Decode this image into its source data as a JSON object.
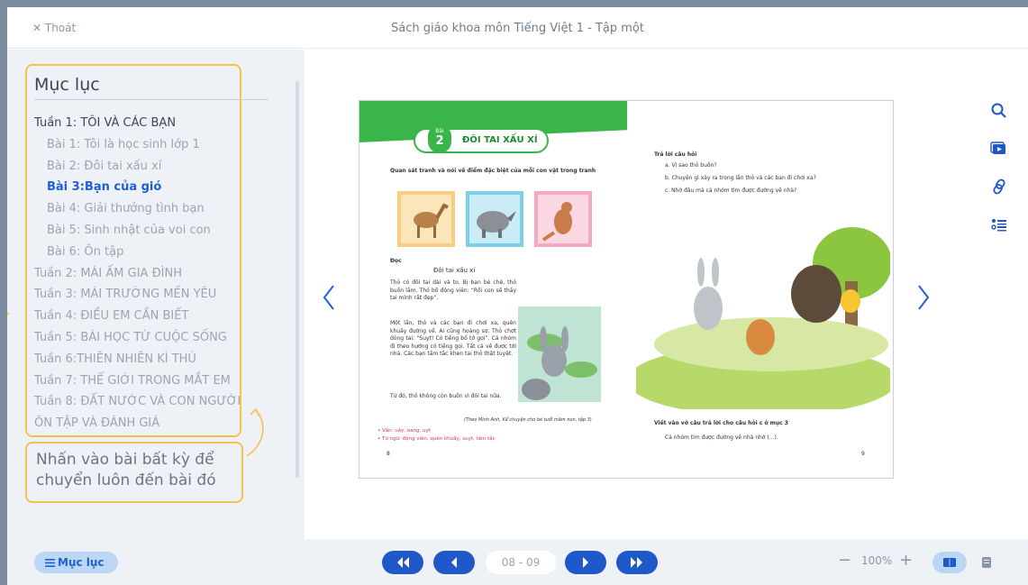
{
  "header": {
    "exit_label": "✕ Thoát",
    "title": "Sách giáo khoa môn Tiếng Việt 1 - Tập một"
  },
  "toc": {
    "title": "Mục lục",
    "items": [
      {
        "label": "Tuần 1: TÔI VÀ CÁC BẠN",
        "kind": "week",
        "state": "expanded"
      },
      {
        "label": "Bài 1: Tôi là học sinh lớp 1",
        "kind": "lesson",
        "state": "normal"
      },
      {
        "label": "Bài 2: Đôi tai xấu xí",
        "kind": "lesson",
        "state": "normal"
      },
      {
        "label": "Bài 3:Bạn của gió",
        "kind": "lesson",
        "state": "active"
      },
      {
        "label": "Bài 4: Giải thưởng tình bạn",
        "kind": "lesson",
        "state": "normal"
      },
      {
        "label": "Bài 5: Sinh nhật của voi con",
        "kind": "lesson",
        "state": "normal"
      },
      {
        "label": "Bài 6: Ôn tập",
        "kind": "lesson",
        "state": "normal"
      },
      {
        "label": "Tuần 2: MÁI ẤM GIA ĐÌNH",
        "kind": "week",
        "state": "normal"
      },
      {
        "label": "Tuần 3: MÁI TRƯỜNG MẾN YÊU",
        "kind": "week",
        "state": "normal"
      },
      {
        "label": "Tuần 4: ĐIỀU EM CẦN BIẾT",
        "kind": "week",
        "state": "normal"
      },
      {
        "label": "Tuần 5: BÀI HỌC TỪ CUỘC SỐNG",
        "kind": "week",
        "state": "normal"
      },
      {
        "label": "Tuần 6:THIÊN NHIÊN KÌ THÚ",
        "kind": "week",
        "state": "normal"
      },
      {
        "label": "Tuần 7: THẾ GIỚI TRONG MẮT EM",
        "kind": "week",
        "state": "normal"
      },
      {
        "label": "Tuần 8: ĐẤT NƯỚC VÀ CON NGƯỜI",
        "kind": "week",
        "state": "normal"
      },
      {
        "label": "ÔN TẬP VÀ ĐÁNH GIÁ",
        "kind": "week",
        "state": "normal"
      }
    ],
    "hint": "Nhấn vào bài bất kỳ để chuyển luôn đến bài đó"
  },
  "book": {
    "left": {
      "lesson_badge_top": "Bài",
      "lesson_badge_num": "2",
      "lesson_title": "ĐÔI TAI XẤU XÍ",
      "q1": "Quan sát tranh và nói về điểm đặc biệt của mỗi con vật trong tranh",
      "q2_label": "Đọc",
      "story_title": "Đôi tai xấu xí",
      "para1": "Thỏ có đôi tai dài và to. Bị bạn bè chê, thỏ buồn lắm. Thỏ bố động viên: “Rồi con sẽ thấy tai mình rất đẹp”.",
      "para2": "Một lần, thỏ và các bạn đi chơi xa, quên khuấy đường về. Ai cũng hoảng sợ. Thỏ chợt dỏng tai: “Suỵt! Có tiếng bố tớ gọi”. Cả nhóm đi theo hướng có tiếng gọi. Tất cả về được tới nhà. Các bạn tấm tắc khen tai thỏ thật tuyệt.",
      "para3": "Từ đó, thỏ không còn buồn vì đôi tai nữa.",
      "source": "(Theo Minh Anh, Kể chuyện cho bé tuổi mầm non, tập 3)",
      "vocab1": "• Vần: uây, oang, uyt",
      "vocab2": "• Từ ngữ: động viên, quên khuấy, suỵt, tấm tắc",
      "page_num": "8"
    },
    "right": {
      "q3_title": "Trả lời câu hỏi",
      "q3a": "a. Vì sao thỏ buồn?",
      "q3b": "b. Chuyện gì xảy ra trong lần thỏ và các bạn đi chơi xa?",
      "q3c": "c. Nhờ đâu mà cả nhóm tìm được đường về nhà?",
      "q4_title": "Viết vào vở câu trả lời cho câu hỏi c ở mục 3",
      "q4_text": "Cả nhóm tìm được đường về nhà nhờ (...).",
      "page_num": "9"
    }
  },
  "toolbar": {
    "toc_button": "Mục lục",
    "page_indicator": "08 - 09",
    "zoom": "100%",
    "icons": [
      "search-icon",
      "video-icon",
      "link-icon",
      "list-icon"
    ]
  },
  "colors": {
    "accent": "#1f58c8",
    "highlight": "#f5c24f",
    "book_green": "#39b54a"
  }
}
